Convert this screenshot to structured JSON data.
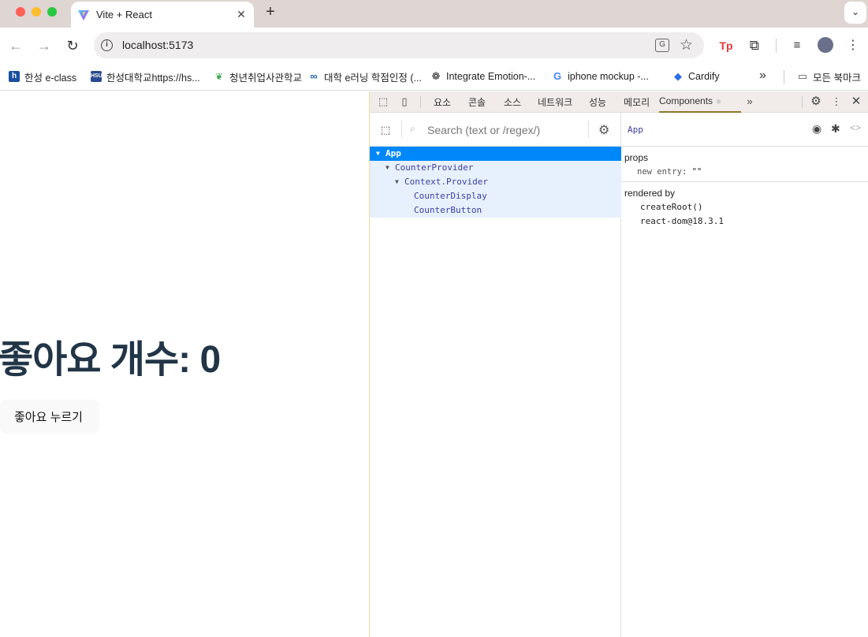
{
  "browser": {
    "tab_title": "Vite + React",
    "url": "localhost:5173",
    "new_tab_symbol": "+",
    "close_symbol": "✕"
  },
  "bookmarks": [
    {
      "label": "한성 e-class",
      "icon": "hansung-logo-icon",
      "color": "#1a4fa0"
    },
    {
      "label": "한성대학교https://hs...",
      "icon": "hsu-logo-icon",
      "color": "#274b8f"
    },
    {
      "label": "청년취업사관학교",
      "icon": "sprout-icon",
      "color": "#3fa34d"
    },
    {
      "label": "대학 e러닝 학점인정 (...",
      "icon": "infinity-icon",
      "color": "#1c5fb8"
    },
    {
      "label": "Integrate Emotion-...",
      "icon": "openai-icon",
      "color": "#222222"
    },
    {
      "label": "iphone mockup -...",
      "icon": "google-icon",
      "color": "#4285f4"
    },
    {
      "label": "Cardify",
      "icon": "diamond-icon",
      "color": "#2f6ee8"
    },
    {
      "label": "모든 북마크",
      "icon": "folder-icon",
      "color": "#555555"
    }
  ],
  "page": {
    "heading": "좋아요 개수: 0",
    "button_label": "좋아요 누르기"
  },
  "devtools": {
    "tabs": [
      "요소",
      "콘솔",
      "소스",
      "네트워크",
      "성능",
      "메모리"
    ],
    "active_tab": "Components",
    "active_tab_badge": "⚛",
    "search_placeholder": "Search (text or /regex/)",
    "tree": [
      {
        "name": "App",
        "depth": 0,
        "expanded": true,
        "selected": true
      },
      {
        "name": "CounterProvider",
        "depth": 1,
        "expanded": true,
        "selected": false
      },
      {
        "name": "Context.Provider",
        "depth": 2,
        "expanded": true,
        "selected": false
      },
      {
        "name": "CounterDisplay",
        "depth": 3,
        "expanded": false,
        "selected": false
      },
      {
        "name": "CounterButton",
        "depth": 3,
        "expanded": false,
        "selected": false
      }
    ],
    "selected_component": "App",
    "props_title": "props",
    "props": [
      {
        "key": "new entry",
        "value": "\"\""
      }
    ],
    "rendered_by_title": "rendered by",
    "rendered_by": [
      "createRoot()",
      "react-dom@18.3.1"
    ]
  },
  "colors": {
    "tab_strip": "#dfd5d3",
    "heading": "#213547",
    "tree_selected": "#0088fa",
    "tree_text": "#3d3da3"
  }
}
